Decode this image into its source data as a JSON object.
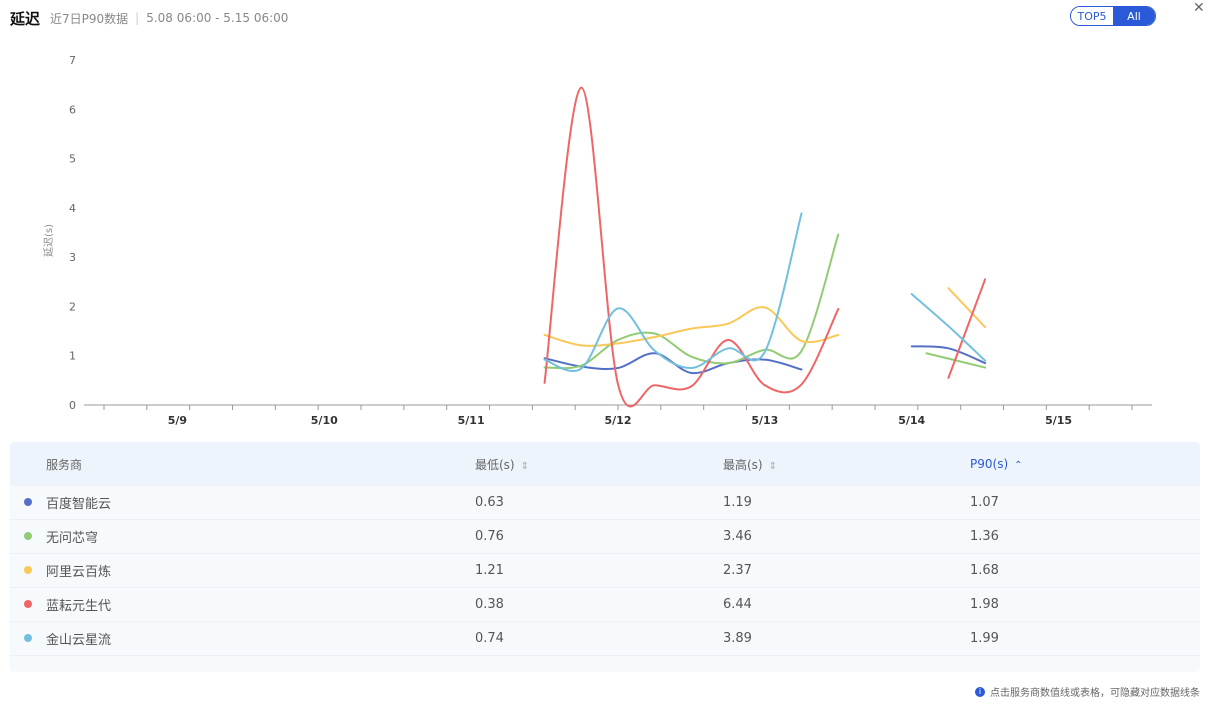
{
  "header": {
    "title": "延迟",
    "subtitle": "近7日P90数据",
    "range": "5.08 06:00 - 5.15 06:00",
    "toggle_top5": "TOP5",
    "toggle_all": "All",
    "close_icon": "close-icon"
  },
  "chart_data": {
    "type": "line",
    "ylabel": "延迟(s)",
    "ylim": [
      0,
      7
    ],
    "yticks": [
      "0",
      "1",
      "2",
      "3",
      "4",
      "5",
      "6",
      "7"
    ],
    "xlim": [
      0,
      7
    ],
    "xtick_labels": [
      "5/9",
      "5/10",
      "5/11",
      "5/12",
      "5/13",
      "5/14",
      "5/15"
    ],
    "grid": false,
    "series": [
      {
        "name": "百度智能云",
        "color": "#5470c6",
        "segments": [
          [
            [
              3.0,
              0.95
            ],
            [
              3.25,
              0.78
            ],
            [
              3.5,
              0.75
            ],
            [
              3.75,
              1.05
            ],
            [
              4.0,
              0.65
            ],
            [
              4.25,
              0.85
            ],
            [
              4.5,
              0.92
            ],
            [
              4.75,
              0.72
            ]
          ],
          [
            [
              5.5,
              1.19
            ],
            [
              5.75,
              1.15
            ],
            [
              6.0,
              0.85
            ]
          ]
        ]
      },
      {
        "name": "无问芯穹",
        "color": "#91cc75",
        "segments": [
          [
            [
              3.0,
              0.76
            ],
            [
              3.25,
              0.8
            ],
            [
              3.5,
              1.32
            ],
            [
              3.75,
              1.45
            ],
            [
              4.0,
              0.98
            ],
            [
              4.25,
              0.85
            ],
            [
              4.5,
              1.12
            ],
            [
              4.75,
              1.1
            ],
            [
              5.0,
              3.46
            ]
          ],
          [
            [
              5.6,
              1.05
            ],
            [
              6.0,
              0.76
            ]
          ]
        ]
      },
      {
        "name": "阿里云百炼",
        "color": "#fac858",
        "segments": [
          [
            [
              3.0,
              1.42
            ],
            [
              3.25,
              1.21
            ],
            [
              3.5,
              1.25
            ],
            [
              3.75,
              1.38
            ],
            [
              4.0,
              1.55
            ],
            [
              4.25,
              1.65
            ],
            [
              4.5,
              1.98
            ],
            [
              4.75,
              1.3
            ],
            [
              5.0,
              1.42
            ]
          ],
          [
            [
              5.75,
              2.37
            ],
            [
              6.0,
              1.58
            ]
          ]
        ]
      },
      {
        "name": "蓝耘元生代",
        "color": "#ee6666",
        "segments": [
          [
            [
              3.0,
              0.45
            ],
            [
              3.25,
              6.44
            ],
            [
              3.5,
              0.42
            ],
            [
              3.75,
              0.4
            ],
            [
              4.0,
              0.38
            ],
            [
              4.25,
              1.32
            ],
            [
              4.5,
              0.4
            ],
            [
              4.75,
              0.42
            ],
            [
              5.0,
              1.95
            ]
          ],
          [
            [
              5.75,
              0.55
            ],
            [
              6.0,
              2.55
            ]
          ]
        ]
      },
      {
        "name": "金山云星流",
        "color": "#73c0de",
        "segments": [
          [
            [
              3.0,
              0.92
            ],
            [
              3.25,
              0.74
            ],
            [
              3.5,
              1.96
            ],
            [
              3.75,
              1.1
            ],
            [
              4.0,
              0.75
            ],
            [
              4.25,
              1.15
            ],
            [
              4.5,
              1.08
            ],
            [
              4.75,
              3.89
            ]
          ],
          [
            [
              5.5,
              2.25
            ],
            [
              5.75,
              1.6
            ],
            [
              6.0,
              0.9
            ]
          ]
        ]
      }
    ]
  },
  "table": {
    "headers": {
      "provider": "服务商",
      "min": "最低(s)",
      "max": "最高(s)",
      "p90": "P90(s)",
      "sort_icon": "sort-icon",
      "sort_active_icon": "sort-up-icon"
    },
    "rows": [
      {
        "name": "百度智能云",
        "color": "#5470c6",
        "min": "0.63",
        "max": "1.19",
        "p90": "1.07"
      },
      {
        "name": "无问芯穹",
        "color": "#91cc75",
        "min": "0.76",
        "max": "3.46",
        "p90": "1.36"
      },
      {
        "name": "阿里云百炼",
        "color": "#fac858",
        "min": "1.21",
        "max": "2.37",
        "p90": "1.68"
      },
      {
        "name": "蓝耘元生代",
        "color": "#ee6666",
        "min": "0.38",
        "max": "6.44",
        "p90": "1.98"
      },
      {
        "name": "金山云星流",
        "color": "#73c0de",
        "min": "0.74",
        "max": "3.89",
        "p90": "1.99"
      }
    ]
  },
  "note": {
    "icon": "info-icon",
    "text": "点击服务商数值线或表格，可隐藏对应数据线条"
  }
}
